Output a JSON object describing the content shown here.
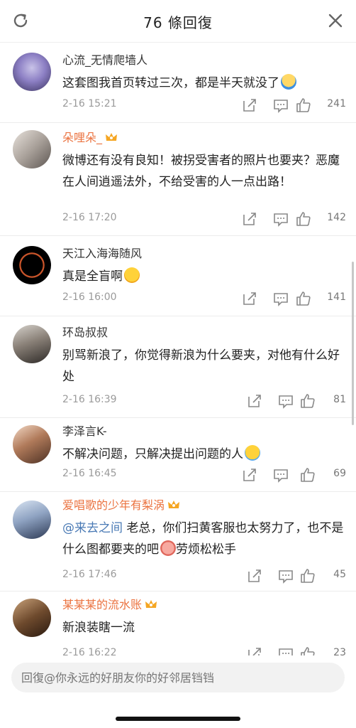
{
  "header": {
    "title": "76 條回復",
    "refresh_icon": "refresh-icon",
    "close_icon": "close-icon"
  },
  "comments": [
    {
      "user": "心流_无情爬墙人",
      "vip": false,
      "text": "这套图我首页转过三次，都是半天就没了",
      "emoji": "shocked-emoji",
      "time": "2-16 15:21",
      "likes": "241"
    },
    {
      "user": "朵哩朵_",
      "vip": true,
      "text": "微博还有没有良知！被拐受害者的照片也要夹？恶魔在人间逍遥法外，不给受害的人一点出路！",
      "time": "2-16 17:20",
      "likes": "142"
    },
    {
      "user": "天江入海海随风",
      "vip": false,
      "text": "真是全盲啊",
      "emoji": "crying-laughing-emoji",
      "time": "2-16 16:00",
      "likes": "141"
    },
    {
      "user": "环岛叔叔",
      "vip": false,
      "text": "别骂新浪了，你觉得新浪为什么要夹，对他有什么好处",
      "time": "2-16 16:39",
      "likes": "81"
    },
    {
      "user": "李泽言K-",
      "vip": false,
      "text": "不解决问题，只解决提出问题的人",
      "emoji": "crying-emoji",
      "time": "2-16 16:45",
      "likes": "69"
    },
    {
      "user": "爱唱歌的少年有梨涡",
      "vip": true,
      "mention": "@来去之间",
      "text": " 老总，你们扫黄客服也太努力了，也不是什么图都要夹的吧",
      "text_after": "劳烦松松手",
      "emoji": "pig-emoji",
      "time": "2-16 17:46",
      "likes": "45"
    },
    {
      "user": "某某某的流水账",
      "vip": true,
      "text": "新浪装瞎一流",
      "time": "2-16 16:22",
      "likes": "23"
    }
  ],
  "reply": {
    "placeholder": "回復@你永远的好朋友你的好邻居铛铛"
  },
  "colors": {
    "vip_name": "#eb7340",
    "mention": "#4a7ab5",
    "meta": "#9a9a9a"
  }
}
